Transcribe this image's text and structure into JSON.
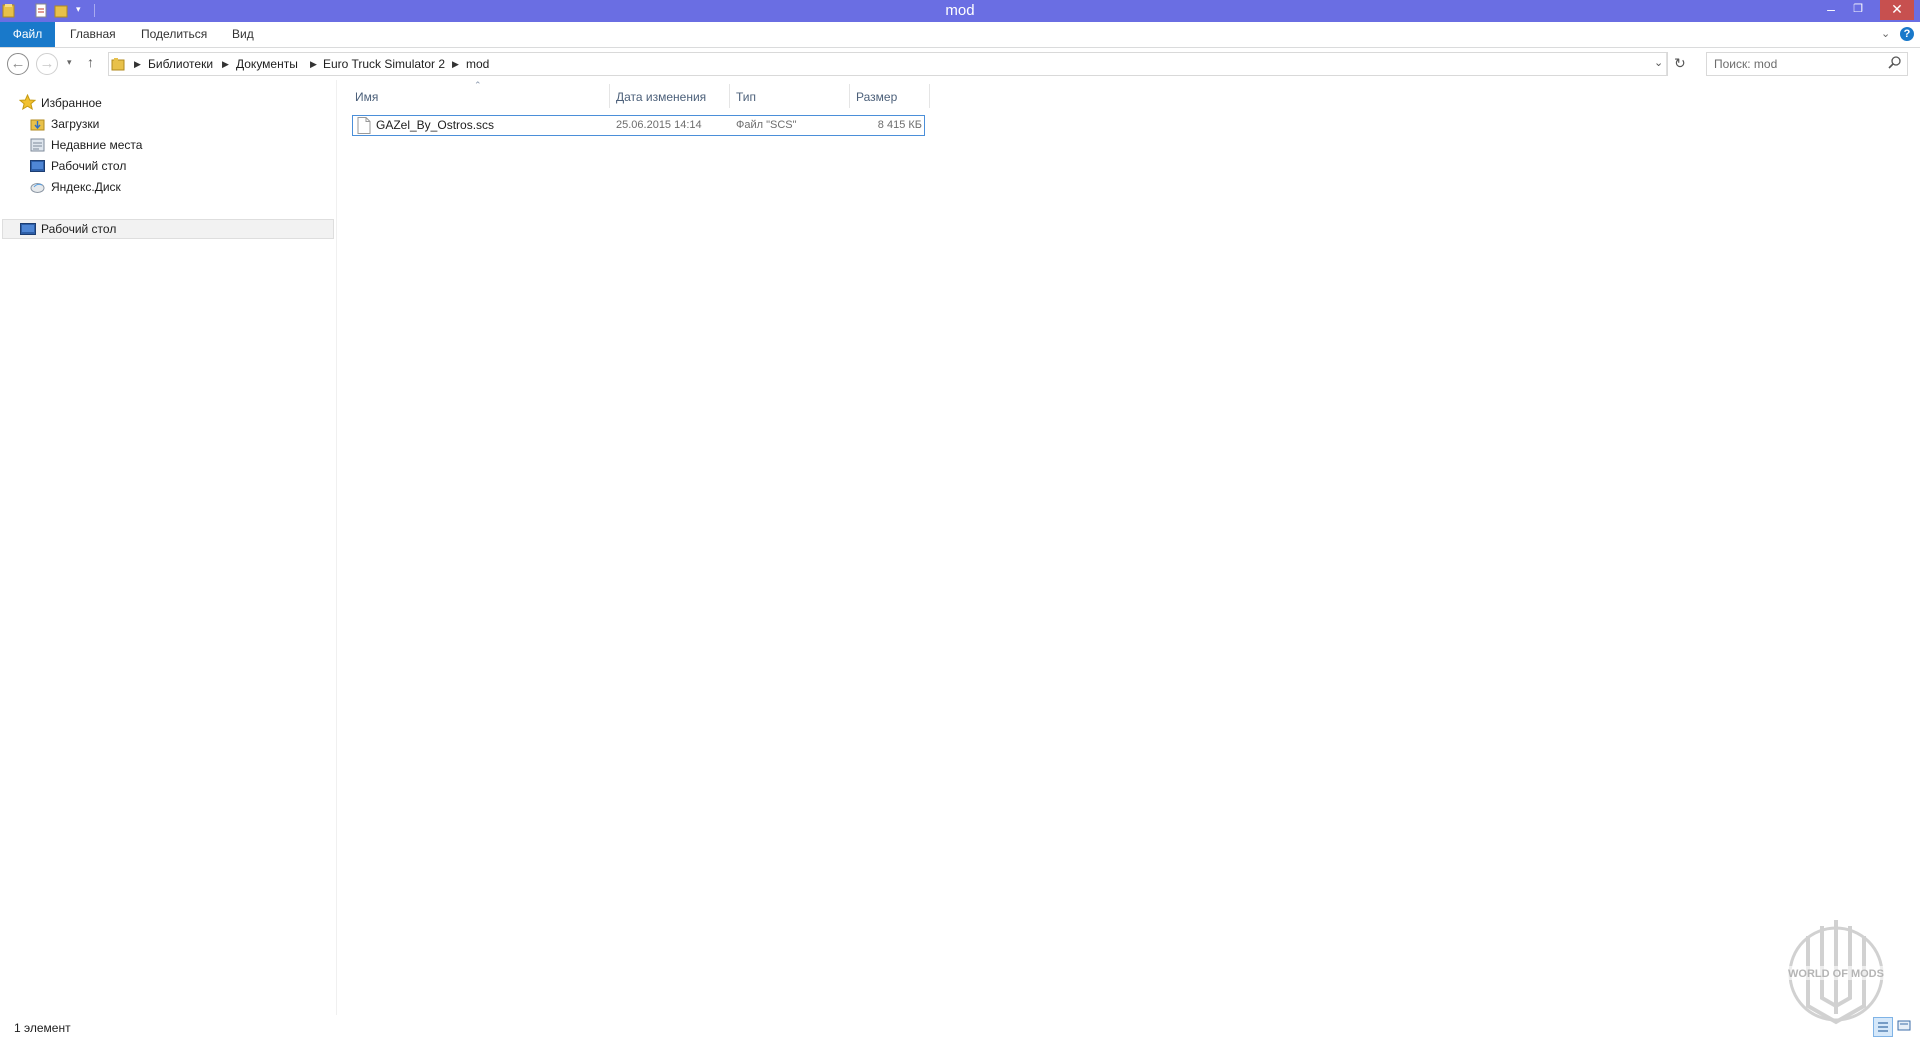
{
  "window": {
    "title": "mod",
    "controls": {
      "minimize": "–",
      "restore": "❐",
      "close": "✕"
    }
  },
  "ribbon": {
    "tabs": [
      "Файл",
      "Главная",
      "Поделиться",
      "Вид"
    ],
    "help": "?"
  },
  "address": {
    "breadcrumbs": [
      "Библиотеки",
      "Документы",
      "Euro Truck Simulator 2",
      "mod"
    ]
  },
  "search": {
    "placeholder": "Поиск: mod"
  },
  "sidebar": {
    "favorites_header": "Избранное",
    "favorites": [
      {
        "label": "Загрузки",
        "icon": "downloads-icon"
      },
      {
        "label": "Недавние места",
        "icon": "recent-places-icon"
      },
      {
        "label": "Рабочий стол",
        "icon": "desktop-icon"
      },
      {
        "label": "Яндекс.Диск",
        "icon": "yandex-disk-icon"
      }
    ],
    "desktop_root": "Рабочий стол"
  },
  "columns": {
    "name": "Имя",
    "date": "Дата изменения",
    "type": "Тип",
    "size": "Размер"
  },
  "files": [
    {
      "name": "GAZel_By_Ostros.scs",
      "date": "25.06.2015 14:14",
      "type": "Файл \"SCS\"",
      "size": "8 415 КБ"
    }
  ],
  "status": {
    "count_text": "1 элемент"
  },
  "watermark": {
    "text": "WORLD OF MODS"
  },
  "colors": {
    "titlebar": "#6a6ee3",
    "file_tab": "#1979ca",
    "selection_border": "#4b8fd9"
  }
}
